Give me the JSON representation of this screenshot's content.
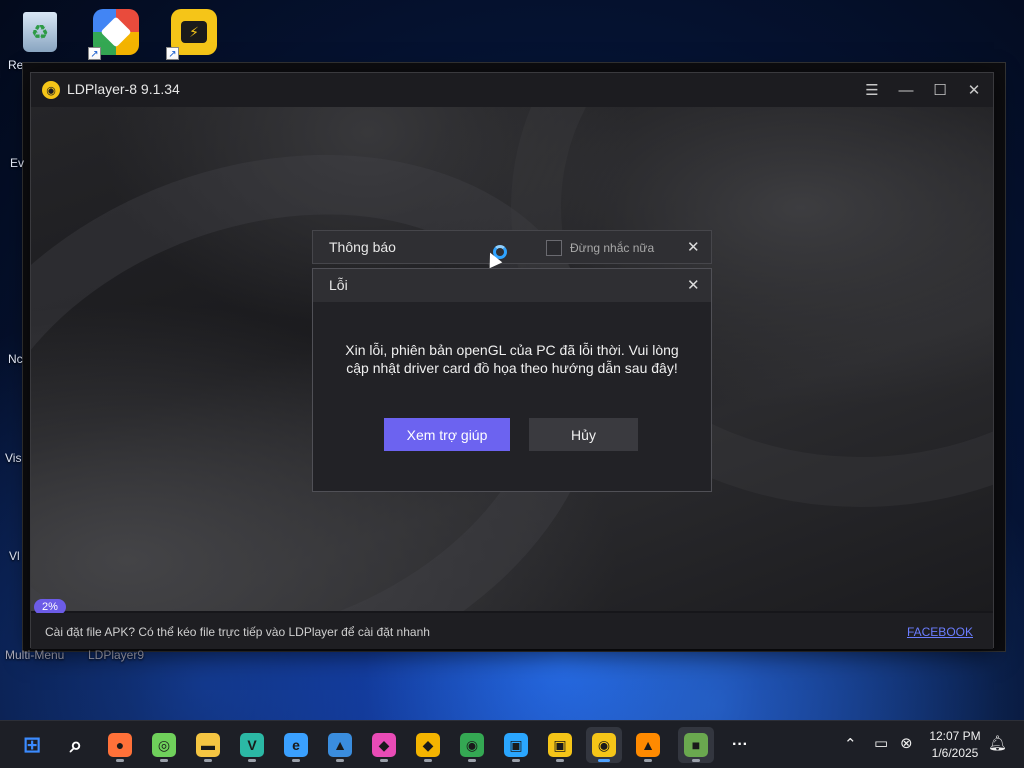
{
  "desktop": {
    "icons": [
      {
        "name": "recycle-bin",
        "label": "Re"
      },
      {
        "name": "ldplayer9-shortcut",
        "label": ""
      },
      {
        "name": "ldmultiplayer-shortcut",
        "label": ""
      }
    ],
    "side_labels": [
      "Ev",
      "Nc",
      "Vis",
      "Vl"
    ],
    "bottom_labels": [
      "Multi-Menu",
      "LDPlayer9"
    ]
  },
  "window": {
    "title": "LDPlayer-8 9.1.34",
    "progress_label": "2%",
    "progress_value": 0.02,
    "tip_text": "Cài đặt file APK? Có thể kéo file trực tiếp vào LDPlayer để cài đặt nhanh",
    "link_text": "FACEBOOK"
  },
  "notice": {
    "title": "Thông báo",
    "dont_remind_label": "Đừng nhắc nữa",
    "dont_remind_checked": false
  },
  "error_dialog": {
    "title": "Lỗi",
    "message": "Xin lỗi, phiên bản openGL của PC đã lỗi thời. Vui lòng cập nhật driver card đồ họa theo hướng dẫn sau đây!",
    "help_button": "Xem trợ giúp",
    "cancel_button": "Hủy"
  },
  "taskbar": {
    "apps": [
      {
        "name": "start",
        "glyph": "⊞",
        "color": "#3b8bff"
      },
      {
        "name": "search",
        "glyph": "⌕",
        "color": "#ffffff"
      },
      {
        "name": "firefox",
        "glyph": "●",
        "color": "#ff7139"
      },
      {
        "name": "cd-burner",
        "glyph": "◎",
        "color": "#6fd05b"
      },
      {
        "name": "file-explorer",
        "glyph": "▬",
        "color": "#f5c542"
      },
      {
        "name": "visual-studio-code",
        "glyph": "V",
        "color": "#2bb8a5"
      },
      {
        "name": "internet-explorer",
        "glyph": "e",
        "color": "#3aa0ff"
      },
      {
        "name": "photos",
        "glyph": "▲",
        "color": "#3a8dde"
      },
      {
        "name": "colorful-app",
        "glyph": "◆",
        "color": "#e94bb6"
      },
      {
        "name": "ldplayer9",
        "glyph": "◆",
        "color": "#f4b400"
      },
      {
        "name": "chrome",
        "glyph": "◉",
        "color": "#34a853"
      },
      {
        "name": "network-app",
        "glyph": "▣",
        "color": "#2aa6ff"
      },
      {
        "name": "ldmultiplayer",
        "glyph": "▣",
        "color": "#f5c518"
      },
      {
        "name": "ldplayer8",
        "glyph": "◉",
        "color": "#f5c518"
      },
      {
        "name": "vlc",
        "glyph": "▲",
        "color": "#ff8a00"
      },
      {
        "name": "minecraft",
        "glyph": "■",
        "color": "#6aa84f"
      },
      {
        "name": "more",
        "glyph": "···",
        "color": "#ffffff"
      }
    ],
    "time": "12:07 PM",
    "date": "1/6/2025"
  }
}
